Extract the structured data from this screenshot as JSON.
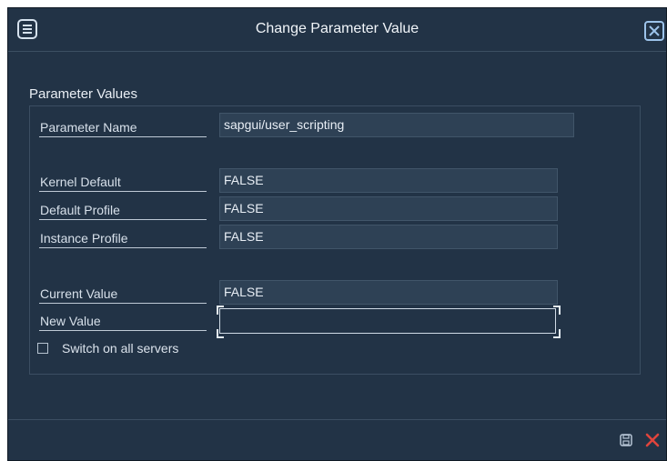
{
  "window": {
    "title": "Change Parameter Value"
  },
  "header": {
    "menu_icon": "menu-icon",
    "close_icon": "close-icon"
  },
  "group": {
    "title": "Parameter Values"
  },
  "fields": {
    "parameter_name": {
      "label": "Parameter Name",
      "value": "sapgui/user_scripting"
    },
    "kernel_default": {
      "label": "Kernel Default",
      "value": "FALSE"
    },
    "default_profile": {
      "label": "Default Profile",
      "value": "FALSE"
    },
    "instance_profile": {
      "label": "Instance Profile",
      "value": "FALSE"
    },
    "current_value": {
      "label": "Current Value",
      "value": "FALSE"
    },
    "new_value": {
      "label": "New Value",
      "value": ""
    }
  },
  "switch_all_servers": {
    "label": "Switch on all servers",
    "checked": false
  },
  "footer": {
    "save_icon": "save-icon",
    "cancel_icon": "cancel-icon"
  },
  "colors": {
    "background": "#223346",
    "field_background": "#2e4155",
    "cancel_red": "#e0443c",
    "close_blue": "#9cc3ea"
  }
}
